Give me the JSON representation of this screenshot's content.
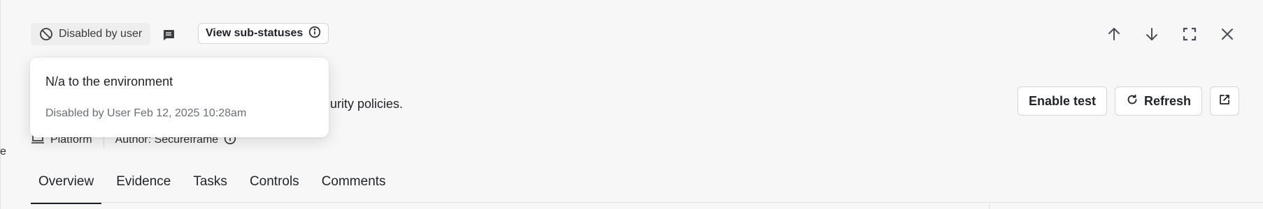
{
  "header": {
    "status_pill": {
      "label": "Disabled by user",
      "icon": "ban-icon"
    },
    "comment_icon": "comment-icon",
    "substatus_button": {
      "label": "View sub-statuses",
      "icon": "info-icon"
    },
    "nav_icons": [
      "arrow-up-icon",
      "arrow-down-icon",
      "expand-icon",
      "close-icon"
    ]
  },
  "popover": {
    "title": "N/a to the environment",
    "meta": "Disabled by User Feb 12, 2025 10:28am"
  },
  "description": {
    "visible_text": "urity policies."
  },
  "meta": {
    "platform_label": "Platform",
    "author_label": "Author: Secureframe"
  },
  "actions": {
    "enable_test_label": "Enable test",
    "refresh_label": "Refresh"
  },
  "tabs": [
    {
      "label": "Overview",
      "active": true
    },
    {
      "label": "Evidence",
      "active": false
    },
    {
      "label": "Tasks",
      "active": false
    },
    {
      "label": "Controls",
      "active": false
    },
    {
      "label": "Comments",
      "active": false
    }
  ],
  "left_edge_text": "e",
  "colors": {
    "background": "#f7f7f7",
    "pill_background": "#eeeeee",
    "text": "#1f2328",
    "muted_text": "#6b6f76",
    "border": "#d6d6d6"
  }
}
